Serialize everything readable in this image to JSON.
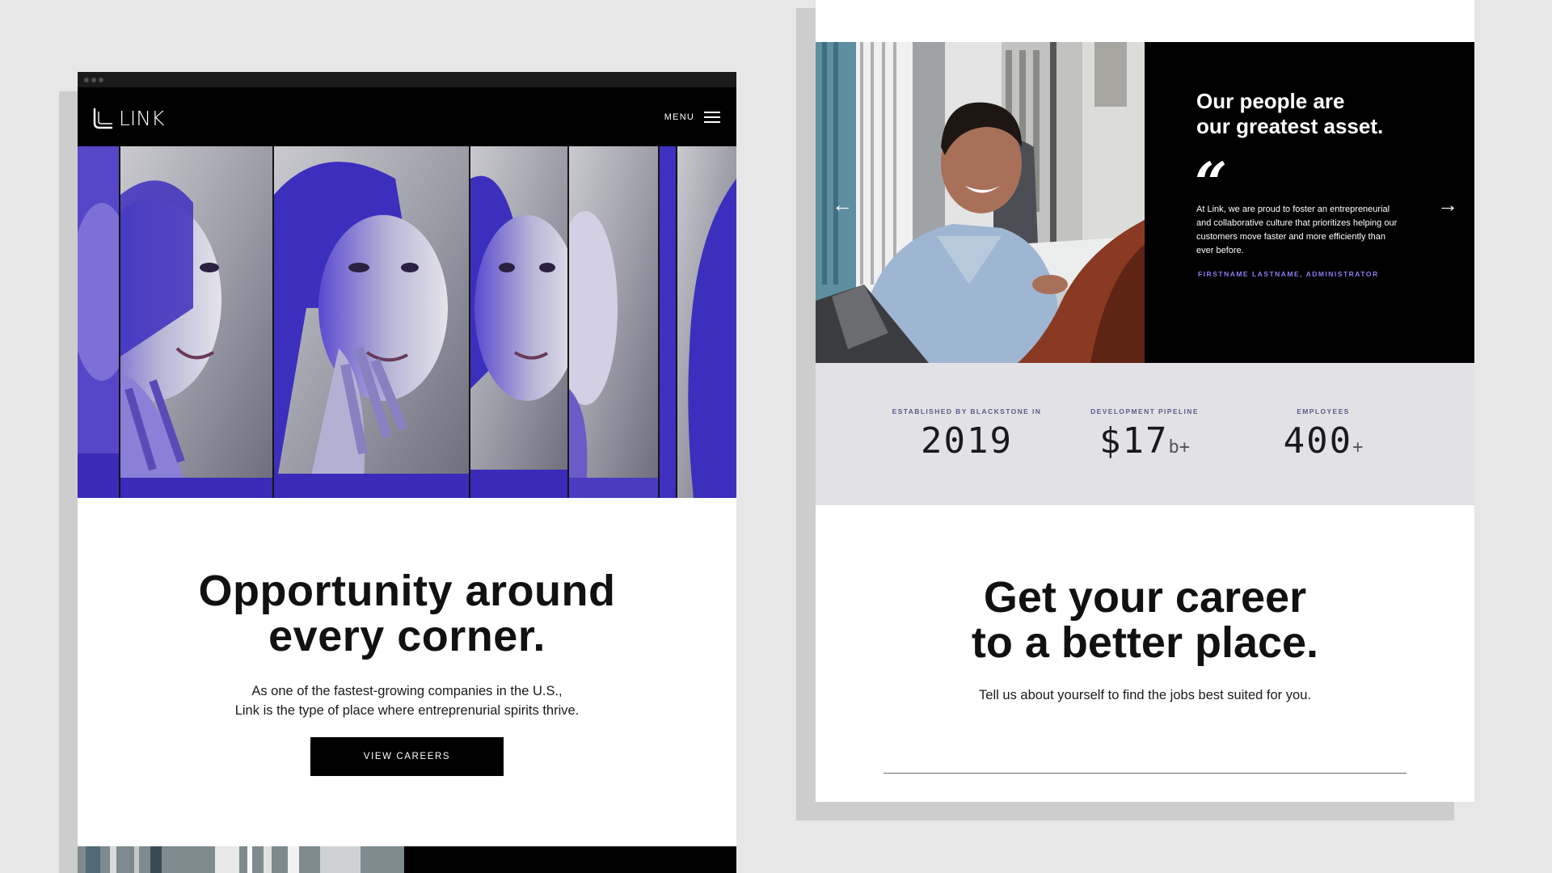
{
  "left_site": {
    "brand": "LINK",
    "menu_label": "MENU",
    "hero": {
      "image_desc_icon": "woman-on-phone-photo",
      "duotone_color": "#4a36c8"
    },
    "headline_line1": "Opportunity around",
    "headline_line2": "every corner.",
    "body_line1": "As one of the fastest-growing companies in the U.S.,",
    "body_line2": "Link is the type of place where entreprenurial spirits thrive.",
    "cta_label": "VIEW CAREERS"
  },
  "right_site": {
    "testimonial": {
      "title_line1": "Our people are",
      "title_line2": "our greatest asset.",
      "quote_mark": "“",
      "quote": "At Link, we are proud to foster an entrepreneurial and collaborative culture that prioritizes helping our customers move faster and more efficiently than ever before.",
      "author": "FIRSTNAME LASTNAME, ADMINISTRATOR",
      "prev_icon": "arrow-left-icon",
      "next_icon": "arrow-right-icon"
    },
    "stats": [
      {
        "label": "ESTABLISHED BY BLACKSTONE IN",
        "value": "2019",
        "suffix": ""
      },
      {
        "label": "DEVELOPMENT PIPELINE",
        "value": "$17",
        "suffix": "b+"
      },
      {
        "label": "EMPLOYEES",
        "value": "400",
        "suffix": "+"
      }
    ],
    "headline_line1": "Get your career",
    "headline_line2": "to a better place.",
    "body": "Tell us about yourself to find the jobs best suited for you."
  },
  "colors": {
    "background": "#e7e7e7",
    "accent_purple": "#8a7ff0",
    "stats_bg": "#e2e2e6",
    "black": "#000000"
  }
}
